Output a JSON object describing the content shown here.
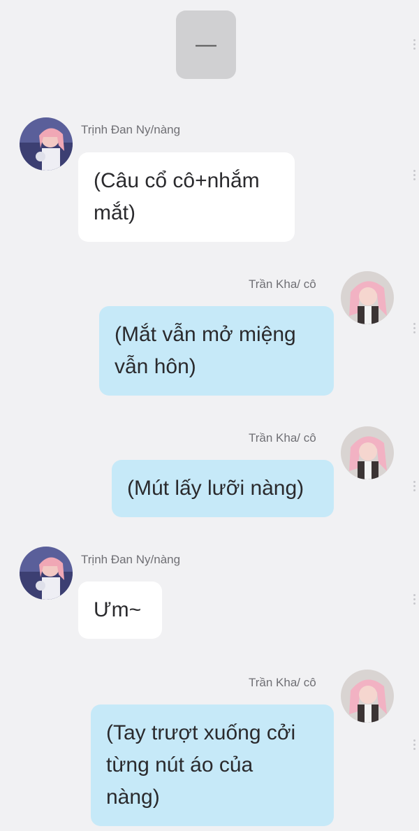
{
  "top_sticker": {
    "glyph": "—"
  },
  "messages": [
    {
      "sender": "Trịnh Đan Ny/nàng",
      "side": "left",
      "text_lines": [
        "(Câu cổ cô+nhắm",
        "mắt)"
      ]
    },
    {
      "sender": "Trần Kha/ cô",
      "side": "right",
      "text_lines": [
        "(Mắt vẫn mở miệng",
        "vẫn hôn)"
      ]
    },
    {
      "sender": "Trần Kha/ cô",
      "side": "right",
      "text_lines": [
        "(Mút lấy lưỡi nàng)"
      ]
    },
    {
      "sender": "Trịnh Đan Ny/nàng",
      "side": "left",
      "text_lines": [
        "Ưm~"
      ]
    },
    {
      "sender": "Trần Kha/ cô",
      "side": "right",
      "text_lines": [
        "(Tay trượt xuống cởi",
        "từng nút áo của",
        "nàng)"
      ]
    }
  ],
  "colors": {
    "background": "#f1f1f3",
    "incoming_bubble": "#ffffff",
    "outgoing_bubble": "#c6e9f8",
    "name_text": "#6f6f74"
  }
}
